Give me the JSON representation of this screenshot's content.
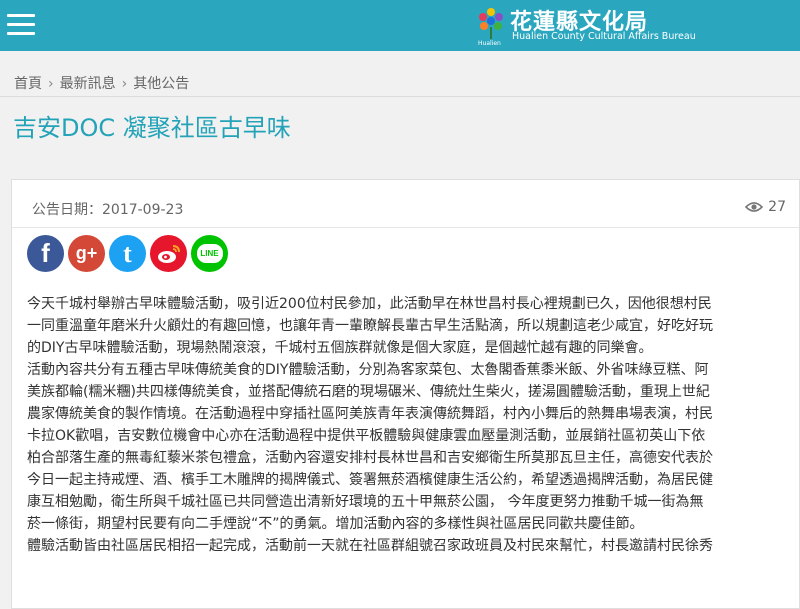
{
  "header": {
    "logo_title": "花蓮縣文化局",
    "logo_subtitle": "Hualien County Cultural Affairs Bureau",
    "logo_small": "Hualien",
    "brand_color": "#2aa7bf"
  },
  "breadcrumb": {
    "items": [
      "首頁",
      "最新訊息",
      "其他公告"
    ],
    "separator": "›"
  },
  "page_title": "吉安DOC 凝聚社區古早味",
  "meta": {
    "date_label": "公告日期：2017-09-23",
    "view_count": "27"
  },
  "share": {
    "facebook": "f",
    "google_plus": "g+",
    "twitter": "t",
    "line": "LINE"
  },
  "article": {
    "lines": [
      "今天千城村舉辦古早味體驗活動，吸引近200位村民參加，此活動早在林世昌村長心裡規劃已久，因他很想村民",
      "一同重溫童年磨米升火顧灶的有趣回憶，也讓年青一輩瞭解長輩古早生活點滴，所以規劃這老少咸宜，好吃好玩",
      "的DIY古早味體驗活動，現場熱鬧滾滾，千城村五個族群就像是個大家庭，是個越忙越有趣的同樂會。",
      "活動內容共分有五種古早味傳統美食的DIY體驗活動，分別為客家菜包、太魯閣香蕉黍米飯、外省味綠豆糕、阿",
      "美族都輪(糯米糰)共四樣傳統美食，並搭配傳統石磨的現場碾米、傳統灶生柴火，搓湯圓體驗活動，重現上世紀",
      "農家傳統美食的製作情境。在活動過程中穿插社區阿美族青年表演傳統舞蹈，村內小舞后的熱舞串場表演，村民",
      "卡拉OK歡唱，吉安數位機會中心亦在活動過程中提供平板體驗與健康雲血壓量測活動，並展銷社區初英山下依",
      "柏合部落生產的無毒紅藜米茶包禮盒，活動內容還安排村長林世昌和吉安鄉衛生所莫那瓦旦主任，高德安代表於",
      "今日一起主持戒煙、酒、檳手工木雕牌的揭牌儀式、簽署無菸酒檳健康生活公約，希望透過揭牌活動，為居民健",
      "康互相勉勵，衛生所與千城社區已共同營造出清新好環境的五十甲無菸公園， 今年度更努力推動千城一街為無",
      "菸一條街，期望村民要有向二手煙說“不”的勇氣。增加活動內容的多樣性與社區居民同歡共慶佳節。",
      "體驗活動皆由社區居民相招一起完成，活動前一天就在社區群組號召家政班員及村民來幫忙，村長邀請村民徐秀"
    ]
  }
}
